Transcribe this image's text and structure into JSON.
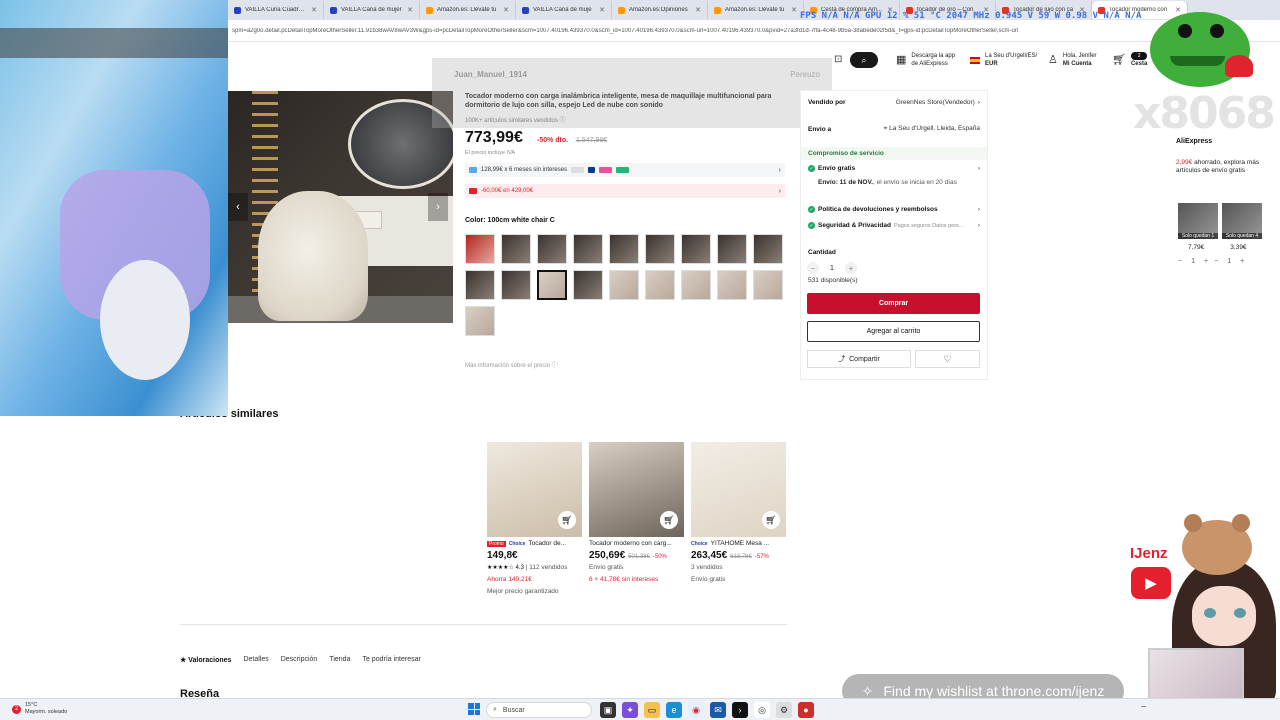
{
  "browser": {
    "tabs": [
      {
        "label": "VAILLA Cuna Cuadros...",
        "icon": "vailla",
        "active": false
      },
      {
        "label": "VAILLA Cana de mujer",
        "icon": "vailla",
        "active": false
      },
      {
        "label": "Amazon.es: Llévate tu",
        "icon": "amazon",
        "active": false
      },
      {
        "label": "VAILLA Cana de muje",
        "icon": "vailla",
        "active": false
      },
      {
        "label": "Amazon.es:Opiniones",
        "icon": "amazon",
        "active": false
      },
      {
        "label": "Amazon.es: Llévate tu",
        "icon": "amazon",
        "active": false
      },
      {
        "label": "Cesta de compra Am...",
        "icon": "amazon",
        "active": false
      },
      {
        "label": "tocador de oro – Con",
        "icon": "aliexpress",
        "active": false
      },
      {
        "label": "Tocador de lujo con ca",
        "icon": "aliexpress",
        "active": false
      },
      {
        "label": "Tocador moderno con",
        "icon": "aliexpress",
        "active": true
      }
    ],
    "url": "spm=a2g0o.detail.pcDetailTopMoreOtherSeller.11.91b38wAV8wAV3W&gps-id=pcDetailTopMoreOtherSeller&scm=1007.40196.439370.0&scm_id=1007.40196.439370.0&scm-url=1007.40196.439370.0&pvid=27a3fd1d-7ffa-4c48-9b5a-38abede02f5d&_t=gps-id:pcDetailTopMoreOtherSeller,scm-url",
    "hw_overlay": "FPS  N/A  N/A     GPU  12 %  51 °C  2047 MHz  0.945 V  59 W  0.98 V  N/A  N/A"
  },
  "header": {
    "download_app_line1": "Descarga la app",
    "download_app_line2": "de AliExpress",
    "locale_line1": "La Seu d'Urgell/ES/",
    "locale_line2": "EUR",
    "account_line1": "Hola, Jenifer",
    "account_line2": "Mi Cuenta",
    "cart_label": "Cesta",
    "cart_count": "2"
  },
  "overlay": {
    "left_text": "Juan_Manuel_1914",
    "right_text": "Pereuzo"
  },
  "product": {
    "title": "Tocador moderno con carga inalámbrica inteligente, mesa de maquillaje multifuncional para dormitorio de lujo con silla, espejo Led de nube con sonido",
    "sold": "100K+ artículos similares vendidos ⓘ",
    "price": "773,99€",
    "discount": "-50% dto.",
    "old_price": "1.547,98€",
    "tax_note": "El precio incluye IVA",
    "installments": "128,99€ x 6 meses sin intereses",
    "coupon": "-60,00€ en 429,00€",
    "color_label": "Color: 100cm white chair C",
    "more_price_info": "Más información sobre el precio ⓘ",
    "swatches": [
      "red",
      "dark",
      "dark",
      "dark",
      "dark",
      "dark",
      "dark",
      "dark",
      "dark",
      "dark",
      "dark",
      "selected",
      "dark",
      "light",
      "light",
      "light",
      "light",
      "light",
      "light"
    ]
  },
  "panel": {
    "seller_label": "Vendido por",
    "seller_value": "GreenNes Store(Vendedor)",
    "ship_label": "Envío a",
    "ship_value": "La Seu d'Urgell, Lleida, España",
    "service_title": "Compromiso de servicio",
    "free_shipping": "Envío gratis",
    "delivery_bold": "Envío: 11 de NOV.",
    "delivery_rest": ", el envío se inicia en 20 días",
    "returns": "Política de devoluciones y reembolsos",
    "security": "Seguridad & Privacidad",
    "security_sub": "Pagos seguros Datos pers...",
    "qty_label": "Cantidad",
    "qty_value": "1",
    "available": "531 disponible(s)",
    "buy": "Comprar",
    "add_cart": "Agregar al carrito",
    "share": "Compartir"
  },
  "side_widget": {
    "title": "AliExpress",
    "saved_amount": "2,99€",
    "saved_text": " ahorrado, explora más artículos de envío gratis",
    "items": [
      {
        "left": "Solo quedan 1",
        "price": "7,79€",
        "qty": "1"
      },
      {
        "left": "Solo quedan 4",
        "price": "3,39€",
        "qty": "1"
      }
    ]
  },
  "similar": {
    "title": "Artículos similares",
    "items": [
      {
        "badge": "Promo",
        "choice": "Choice",
        "name": "Tocador de...",
        "price": "149,8€",
        "old": "",
        "disc": "",
        "rating": "★★★★☆ 4.3",
        "meta1": "| 112 vendidos",
        "meta2": "Ahorra 149,21€",
        "meta3": "Mejor precio garantizado"
      },
      {
        "badge": "",
        "choice": "",
        "name": "Tocador moderno con carg...",
        "price": "250,69€",
        "old": "501,38€",
        "disc": "-50%",
        "rating": "",
        "meta1": "Envío gratis",
        "meta2": "6 × 41,78€ sin intereses",
        "meta3": ""
      },
      {
        "badge": "",
        "choice": "Choice",
        "name": "YITAHOME Mesa ...",
        "price": "263,45€",
        "old": "613,78€",
        "disc": "-57%",
        "rating": "",
        "meta1": "3 vendidos",
        "meta2": "Envío gratis",
        "meta3": ""
      }
    ]
  },
  "page_tabs": [
    "Valoraciones",
    "Detalles",
    "Descripción",
    "Tienda",
    "Te podría interesar"
  ],
  "reviews_heading": "Reseña",
  "stream": {
    "code": "x8068",
    "name": "IJenz",
    "wishlist": "Find my wishlist at throne.com/ijenz"
  },
  "taskbar": {
    "weather_temp": "15°C",
    "weather_desc": "Mayorm. soleado",
    "weather_badge": "2",
    "search": "Buscar"
  }
}
